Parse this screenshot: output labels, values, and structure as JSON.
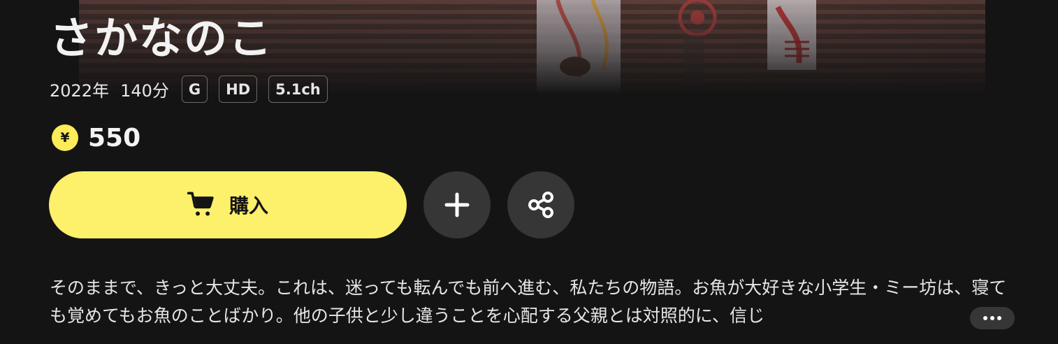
{
  "title": "さかなのこ",
  "meta": {
    "year": "2022年",
    "duration": "140分",
    "badges": [
      "G",
      "HD",
      "5.1ch"
    ]
  },
  "price": {
    "currency_symbol": "¥",
    "value": "550"
  },
  "buttons": {
    "buy_label": "購入",
    "add_icon": "plus-icon",
    "share_icon": "share-icon",
    "more_icon": "ellipsis-icon",
    "cart_icon": "cart-icon"
  },
  "synopsis": "そのままで、きっと大丈夫。これは、迷っても転んでも前へ進む、私たちの物語。お魚が大好きな小学生・ミー坊は、寝ても覚めてもお魚のことばかり。他の子供と少し違うことを心配する父親とは対照的に、信じ",
  "colors": {
    "accent": "#fdf06a",
    "background": "#141414",
    "button_dark": "#363636"
  }
}
